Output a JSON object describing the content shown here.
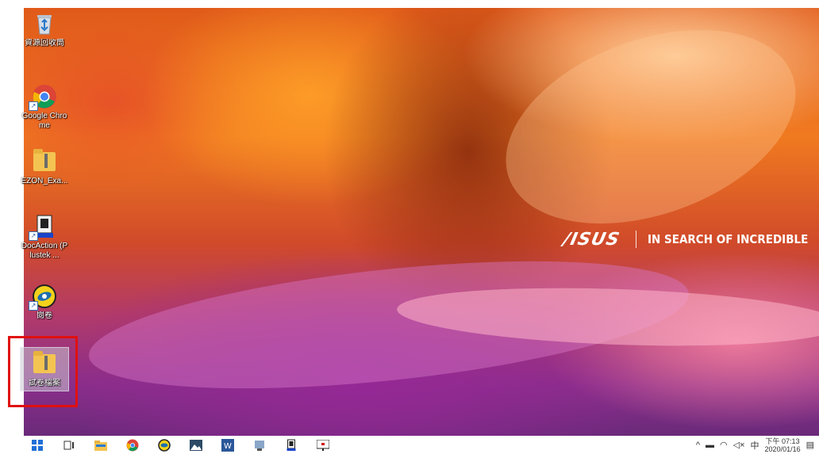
{
  "desktop": {
    "icons": [
      {
        "id": "recycle-bin",
        "label": "資源回收筒",
        "icon": "recycle-bin-icon"
      },
      {
        "id": "google-chrome",
        "label": "Google Chrome",
        "icon": "chrome-icon"
      },
      {
        "id": "ezon",
        "label": "EZON_Exa...",
        "icon": "folder-icon"
      },
      {
        "id": "docaction",
        "label": "DocAction (Plustek ...",
        "icon": "docaction-icon"
      },
      {
        "id": "app-yellow",
        "label": "閱卷",
        "icon": "scan-app-icon"
      },
      {
        "id": "exam-files",
        "label": "試卷檔案",
        "icon": "folder-icon",
        "selected": true
      }
    ],
    "brand": {
      "logo": "/ISUS",
      "tagline": "IN SEARCH OF INCREDIBLE"
    }
  },
  "taskbar": {
    "apps": [
      "windows-start-icon",
      "task-view-icon",
      "file-explorer-icon",
      "chrome-icon",
      "scan-app-icon",
      "photos-icon",
      "word-icon",
      "explorer-network-icon",
      "docaction-icon",
      "presentation-icon"
    ],
    "tray": {
      "ime": "中",
      "time": "下午 07:13",
      "date": "2020/01/16"
    }
  },
  "colors": {
    "highlight": "#e01010",
    "taskbar": "#ffffff"
  }
}
